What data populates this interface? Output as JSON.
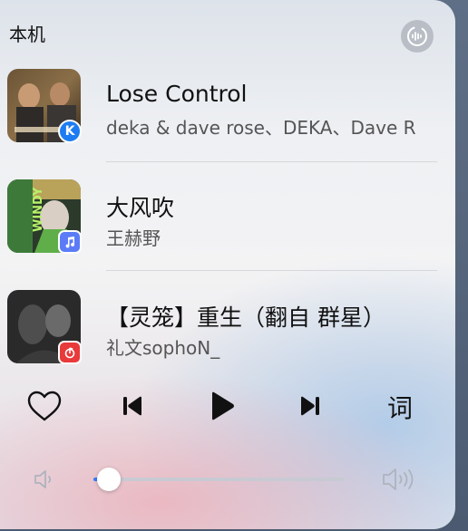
{
  "header": {
    "title": "本机",
    "cast_icon": "audio-output-icon"
  },
  "tracks": [
    {
      "title": "Lose Control",
      "artist": "deka & dave rose、DEKA、Dave R",
      "app_icon": "kugou-icon",
      "app_letter": "K",
      "app_color": "#1e7cf2"
    },
    {
      "title": "大风吹",
      "artist": "王赫野",
      "app_icon": "apple-music-icon",
      "app_color": "#5b7cf6"
    },
    {
      "title": "【灵笼】重生（翻自 群星）",
      "artist": "礼文sophoN_",
      "app_icon": "netease-music-icon",
      "app_color": "#e83a3a"
    }
  ],
  "controls": {
    "like_icon": "heart-icon",
    "prev_icon": "previous-icon",
    "play_icon": "play-icon",
    "next_icon": "next-icon",
    "lyrics_label": "词"
  },
  "volume": {
    "low_icon": "volume-low-icon",
    "high_icon": "volume-high-icon",
    "level": 0.06,
    "accent": "#3c7bff"
  }
}
